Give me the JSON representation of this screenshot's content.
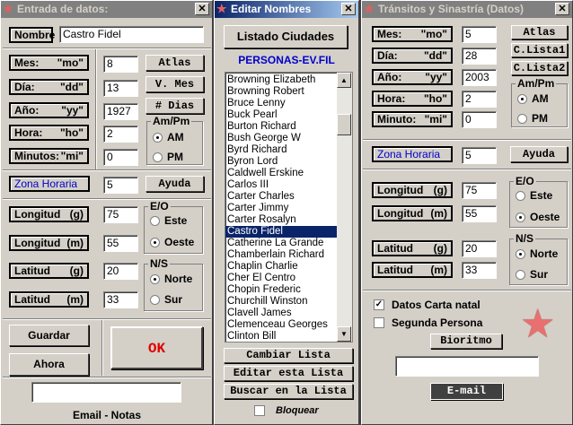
{
  "left": {
    "title": "Entrada de datos:",
    "nombre_label": "Nombre",
    "nombre_value": "Castro Fidel",
    "rows": [
      {
        "l": "Mes:",
        "c": "\"mo\"",
        "v": "8"
      },
      {
        "l": "Día:",
        "c": "\"dd\"",
        "v": "13"
      },
      {
        "l": "Año:",
        "c": "\"yy\"",
        "v": "1927"
      },
      {
        "l": "Hora:",
        "c": "\"ho\"",
        "v": "2"
      },
      {
        "l": "Minutos:",
        "c": "\"mi\"",
        "v": "0"
      }
    ],
    "atlas": "Atlas",
    "vmes": "V. Mes",
    "dias": "# Dias",
    "ampm": "Am/Pm",
    "am": "AM",
    "pm": "PM",
    "zona": "Zona Horaria",
    "zona_value": "5",
    "ayuda": "Ayuda",
    "coords": [
      {
        "l": "Longitud",
        "c": "(g)",
        "v": "75"
      },
      {
        "l": "Longitud",
        "c": "(m)",
        "v": "55"
      },
      {
        "l": "Latitud",
        "c": "(g)",
        "v": "20"
      },
      {
        "l": "Latitud",
        "c": "(m)",
        "v": "33"
      }
    ],
    "eo": "E/O",
    "este": "Este",
    "oeste": "Oeste",
    "ns": "N/S",
    "norte": "Norte",
    "sur": "Sur",
    "guardar": "Guardar",
    "ahora": "Ahora",
    "ok": "OK",
    "email_notes_value": "",
    "email_notas": "Email - Notas"
  },
  "middle": {
    "title": "Editar Nombres",
    "listado": "Listado Ciudades",
    "file": "PERSONAS-EV.FIL",
    "items": [
      "Browning Elizabeth",
      "Browning Robert",
      "Bruce Lenny",
      "Buck Pearl",
      "Burton Richard",
      "Bush George W",
      "Byrd Richard",
      "Byron Lord",
      "Caldwell Erskine",
      "Carlos III",
      "Carter Charles",
      "Carter Jimmy",
      "Carter Rosalyn",
      "Castro Fidel",
      "Catherine La Grande",
      "Chamberlain Richard",
      "Chaplin Charlie",
      "Cher El Centro",
      "Chopin Frederic",
      "Churchill Winston",
      "Clavell James",
      "Clemenceau Georges",
      "Clinton Bill"
    ],
    "selected": "Castro Fidel",
    "cambiar": "Cambiar Lista",
    "editar": "Editar esta Lista",
    "buscar": "Buscar en la Lista",
    "bloquear": "Bloquear"
  },
  "right": {
    "title": "Tránsitos y Sinastría (Datos)",
    "rows": [
      {
        "l": "Mes:",
        "c": "\"mo\"",
        "v": "5"
      },
      {
        "l": "Día:",
        "c": "\"dd\"",
        "v": "28"
      },
      {
        "l": "Año:",
        "c": "\"yy\"",
        "v": "2003"
      },
      {
        "l": "Hora:",
        "c": "\"ho\"",
        "v": "2"
      },
      {
        "l": "Minuto:",
        "c": "\"mi\"",
        "v": "0"
      }
    ],
    "atlas": "Atlas",
    "clista1": "C.Lista1",
    "clista2": "C.Lista2",
    "ampm": "Am/Pm",
    "am": "AM",
    "pm": "PM",
    "zona": "Zona Horaria",
    "zona_value": "5",
    "ayuda": "Ayuda",
    "coords": [
      {
        "l": "Longitud",
        "c": "(g)",
        "v": "75"
      },
      {
        "l": "Longitud",
        "c": "(m)",
        "v": "55"
      },
      {
        "l": "Latitud",
        "c": "(g)",
        "v": "20"
      },
      {
        "l": "Latitud",
        "c": "(m)",
        "v": "33"
      }
    ],
    "eo": "E/O",
    "este": "Este",
    "oeste": "Oeste",
    "ns": "N/S",
    "norte": "Norte",
    "sur": "Sur",
    "datos_carta": "Datos Carta natal",
    "segunda": "Segunda Persona",
    "bioritmo": "Bioritmo",
    "email_value": "",
    "email": "E-mail"
  }
}
